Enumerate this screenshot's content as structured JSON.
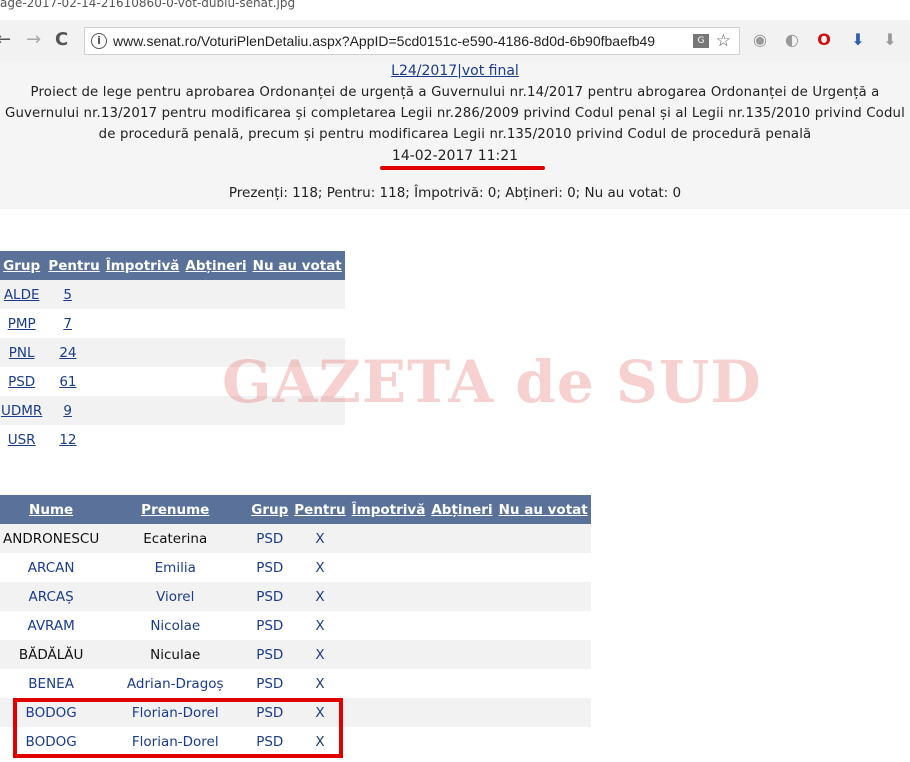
{
  "file_name": "age-2017-02-14-21610860-0-vot-dublu-senat.jpg",
  "browser": {
    "url": "www.senat.ro/VoturiPlenDetaliu.aspx?AppID=5cd0151c-e590-4186-8d0d-6b90fbaefb49",
    "back": "←",
    "forward": "→",
    "reload": "C",
    "star": "☆"
  },
  "vote": {
    "link_text": "L24/2017|vot final",
    "title": "Proiect de lege pentru aprobarea Ordonanței de urgență a Guvernului nr.14/2017 pentru abrogarea Ordonanței de Urgență a Guvernului nr.13/2017 pentru modificarea și completarea Legii nr.286/2009 privind Codul penal și al Legii nr.135/2010 privind Codul de procedură penală, precum și pentru modificarea Legii nr.135/2010 privind Codul de procedură penală",
    "datetime": "14-02-2017 11:21",
    "summary": "Prezenți: 118; Pentru: 118; Împotrivă: 0; Abțineri: 0; Nu au votat: 0"
  },
  "group_table": {
    "headers": [
      "Grup",
      "Pentru",
      "Împotrivă",
      "Abțineri",
      "Nu au votat"
    ],
    "rows": [
      {
        "grup": "ALDE",
        "pentru": "5"
      },
      {
        "grup": "PMP",
        "pentru": "7"
      },
      {
        "grup": "PNL",
        "pentru": "24"
      },
      {
        "grup": "PSD",
        "pentru": "61"
      },
      {
        "grup": "UDMR",
        "pentru": "9"
      },
      {
        "grup": "USR",
        "pentru": "12"
      }
    ]
  },
  "senator_table": {
    "headers": [
      "Nume",
      "Prenume",
      "Grup",
      "Pentru",
      "Împotrivă",
      "Abțineri",
      "Nu au votat"
    ],
    "rows": [
      {
        "nume": "ANDRONESCU",
        "prenume": "Ecaterina",
        "grup": "PSD",
        "pentru": "X"
      },
      {
        "nume": "ARCAN",
        "prenume": "Emilia",
        "grup": "PSD",
        "pentru": "X"
      },
      {
        "nume": "ARCAȘ",
        "prenume": "Viorel",
        "grup": "PSD",
        "pentru": "X"
      },
      {
        "nume": "AVRAM",
        "prenume": "Nicolae",
        "grup": "PSD",
        "pentru": "X"
      },
      {
        "nume": "BĂDĂLĂU",
        "prenume": "Niculae",
        "grup": "PSD",
        "pentru": "X"
      },
      {
        "nume": "BENEA",
        "prenume": "Adrian-Dragoș",
        "grup": "PSD",
        "pentru": "X"
      },
      {
        "nume": "BODOG",
        "prenume": "Florian-Dorel",
        "grup": "PSD",
        "pentru": "X"
      },
      {
        "nume": "BODOG",
        "prenume": "Florian-Dorel",
        "grup": "PSD",
        "pentru": "X"
      }
    ]
  },
  "watermark": "GAZETA de SUD",
  "colors": {
    "header_bg": "#5a7299",
    "link": "#1a3c8a",
    "highlight_red": "#e00000"
  }
}
